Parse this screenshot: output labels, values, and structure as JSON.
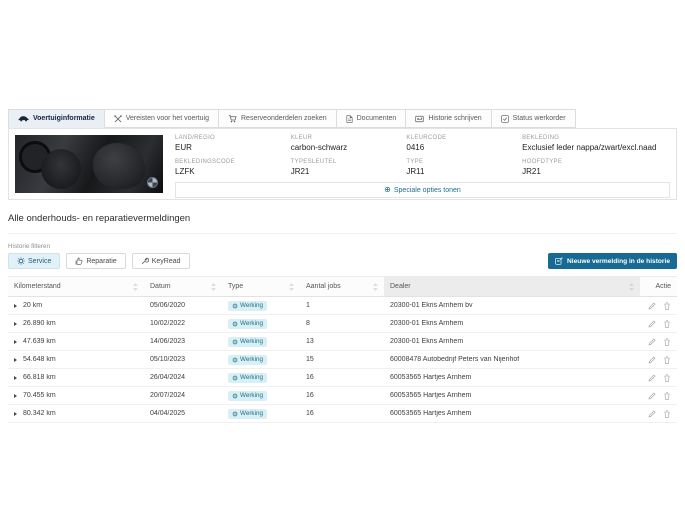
{
  "colors": {
    "accent": "#1c6f93",
    "button": "#166a93",
    "badge_bg": "#d9eff6",
    "badge_text": "#1d7082",
    "active_tab_bg": "#e9eff5",
    "selected_chip_bg": "#e2f0f8"
  },
  "tabs": [
    {
      "label": "Voertuiginformatie",
      "icon": "car-icon",
      "active": true
    },
    {
      "label": "Vereisten voor het voertuig",
      "icon": "tools-icon",
      "active": false
    },
    {
      "label": "Reserveonderdelen zoeken",
      "icon": "cart-icon",
      "active": false
    },
    {
      "label": "Documenten",
      "icon": "document-icon",
      "active": false
    },
    {
      "label": "Historie schrijven",
      "icon": "card-icon",
      "active": false
    },
    {
      "label": "Status werkorder",
      "icon": "status-icon",
      "active": false
    }
  ],
  "vehicle": {
    "image_alt": "vehicle-interior-photo",
    "fields": [
      {
        "label": "LAND/REGIO",
        "value": "EUR"
      },
      {
        "label": "KLEUR",
        "value": "carbon-schwarz"
      },
      {
        "label": "KLEURCODE",
        "value": "0416"
      },
      {
        "label": "BEKLEDING",
        "value": "Exclusief leder nappa/zwart/excl.naad"
      },
      {
        "label": "BEKLEDINGSCODE",
        "value": "LZFK"
      },
      {
        "label": "TYPESLEUTEL",
        "value": "JR21"
      },
      {
        "label": "TYPE",
        "value": "JR11"
      },
      {
        "label": "HOOFDTYPE",
        "value": "JR21"
      }
    ],
    "special_options": {
      "icon": "plus-circle-icon",
      "label": "Speciale opties tonen",
      "glyph": "⊕"
    }
  },
  "history": {
    "heading": "Alle onderhouds- en reparatievermeldingen",
    "filter_label": "Historie filteren",
    "filters": [
      {
        "label": "Service",
        "icon": "gear-icon",
        "selected": true
      },
      {
        "label": "Reparatie",
        "icon": "thumb-up-icon",
        "selected": false
      },
      {
        "label": "KeyRead",
        "icon": "wrench-icon",
        "selected": false
      }
    ],
    "new_entry_button": "Nieuwe vermelding in de historie",
    "table": {
      "columns": [
        "Kilometerstand",
        "Datum",
        "Type",
        "Aantal jobs",
        "Dealer",
        "Actie"
      ],
      "rows": [
        {
          "km": "20 km",
          "date": "05/06/2020",
          "type": "Werking",
          "jobs": "1",
          "dealer": "20300-01 Ekris Arnhem bv"
        },
        {
          "km": "26.890 km",
          "date": "10/02/2022",
          "type": "Werking",
          "jobs": "8",
          "dealer": "20300-01 Ekris Arnhem"
        },
        {
          "km": "47.639 km",
          "date": "14/06/2023",
          "type": "Werking",
          "jobs": "13",
          "dealer": "20300-01 Ekris Arnhem"
        },
        {
          "km": "54.648 km",
          "date": "05/10/2023",
          "type": "Werking",
          "jobs": "15",
          "dealer": "60008478 Autobedrijf Peters van Nijenhof"
        },
        {
          "km": "66.818 km",
          "date": "26/04/2024",
          "type": "Werking",
          "jobs": "16",
          "dealer": "60053565 Hartjes Arnhem"
        },
        {
          "km": "70.455 km",
          "date": "20/07/2024",
          "type": "Werking",
          "jobs": "16",
          "dealer": "60053565 Hartjes Arnhem"
        },
        {
          "km": "80.342 km",
          "date": "04/04/2025",
          "type": "Werking",
          "jobs": "16",
          "dealer": "60053565 Hartjes Arnhem"
        }
      ]
    }
  }
}
